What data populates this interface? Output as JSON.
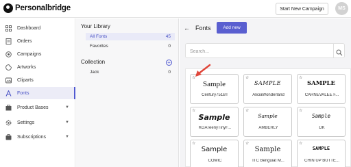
{
  "header": {
    "brand": "Personalbridge",
    "campaign_button": "Start New Campaign",
    "avatar_initials": "MS"
  },
  "sidebar": {
    "items": [
      {
        "label": "Dashboard",
        "icon": "dashboard-icon"
      },
      {
        "label": "Orders",
        "icon": "orders-icon"
      },
      {
        "label": "Campaigns",
        "icon": "campaigns-icon"
      },
      {
        "label": "Artworks",
        "icon": "artworks-icon"
      },
      {
        "label": "Cliparts",
        "icon": "cliparts-icon"
      },
      {
        "label": "Fonts",
        "icon": "fonts-icon",
        "active": true
      },
      {
        "label": "Product Bases",
        "icon": "product-bases-icon"
      },
      {
        "label": "Settings",
        "icon": "settings-icon"
      },
      {
        "label": "Subscriptions",
        "icon": "subscriptions-icon"
      }
    ]
  },
  "library": {
    "title": "Your Library",
    "items": [
      {
        "label": "All Fonts",
        "count": "45"
      },
      {
        "label": "Favorites",
        "count": "0"
      }
    ],
    "collection_title": "Collection",
    "collections": [
      {
        "label": "Jack",
        "count": "0"
      }
    ]
  },
  "main": {
    "title": "Fonts",
    "add_button": "Add new",
    "search_placeholder": "Search..."
  },
  "fonts": [
    {
      "name": "Century751BT",
      "sample": "Sample"
    },
    {
      "name": "AliciaWonderland",
      "sample": "SAMPLE"
    },
    {
      "name": "CARNEVALEE F...",
      "sample": "SAMPLE"
    },
    {
      "name": "KGATeenyTinyF...",
      "sample": "Sample"
    },
    {
      "name": "AMBERLY",
      "sample": "Sample"
    },
    {
      "name": "DK",
      "sample": "Sample"
    },
    {
      "name": "COMIC",
      "sample": "Sample"
    },
    {
      "name": "ITC Benguiat M...",
      "sample": "Sample"
    },
    {
      "name": "CHIN UP BUTTE...",
      "sample": "SAMPLE"
    }
  ],
  "colors": {
    "accent": "#5a5fd0",
    "active_bg": "#ececf7",
    "annotation_arrow": "#e0463a"
  }
}
